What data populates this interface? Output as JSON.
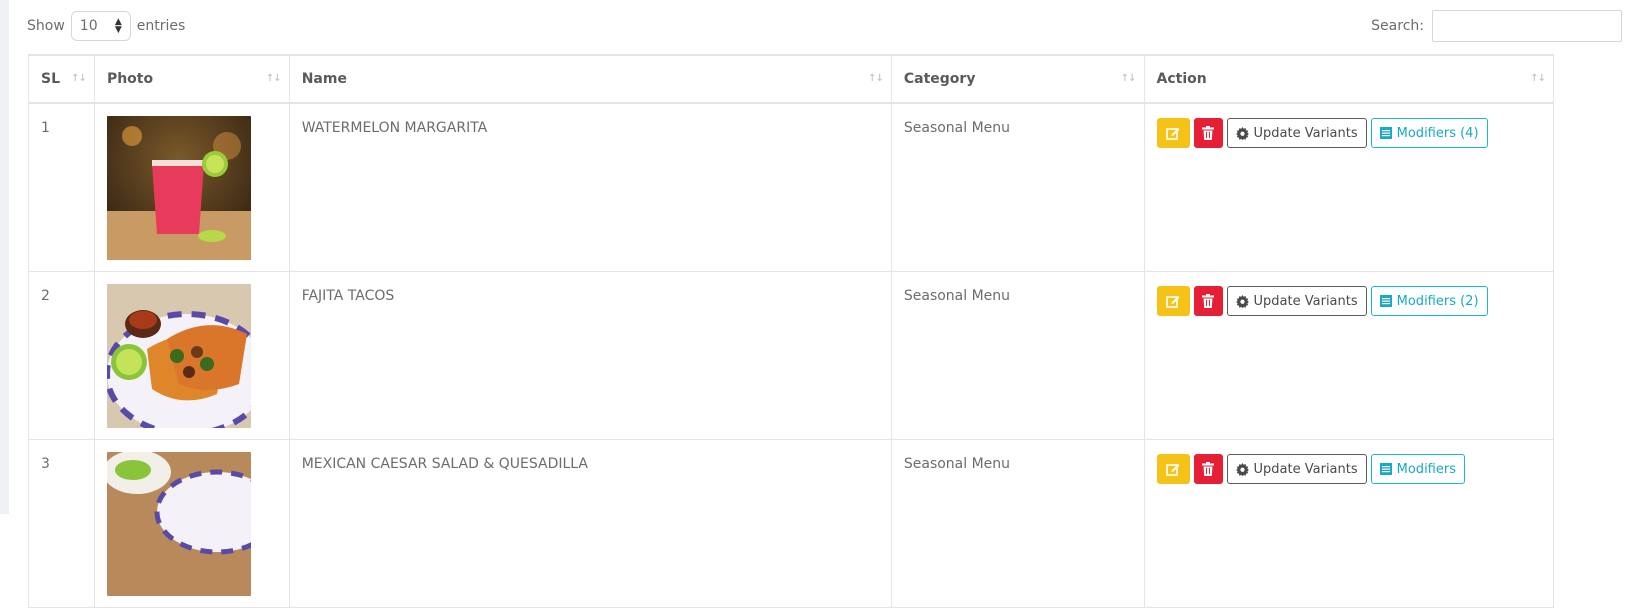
{
  "length_control": {
    "show_label": "Show",
    "selected": "10",
    "entries_label": "entries"
  },
  "search": {
    "label": "Search:",
    "value": ""
  },
  "columns": {
    "sl": "SL",
    "photo": "Photo",
    "name": "Name",
    "category": "Category",
    "action": "Action"
  },
  "rows": [
    {
      "sl": "1",
      "name": "WATERMELON MARGARITA",
      "category": "Seasonal Menu",
      "update_label": "Update Variants",
      "modifiers_label": "Modifiers (4)",
      "photo_icon": "drink-photo"
    },
    {
      "sl": "2",
      "name": "FAJITA TACOS",
      "category": "Seasonal Menu",
      "update_label": "Update Variants",
      "modifiers_label": "Modifiers (2)",
      "photo_icon": "tacos-photo"
    },
    {
      "sl": "3",
      "name": "MEXICAN CAESAR SALAD & QUESADILLA",
      "category": "Seasonal Menu",
      "update_label": "Update Variants",
      "modifiers_label": "Modifiers",
      "photo_icon": "salad-photo"
    }
  ],
  "icons": {
    "edit": "edit-icon",
    "delete": "trash-icon",
    "variants": "gear-icon",
    "modifiers": "list-icon",
    "sort": "sort-icon",
    "select_arrows": "chevron-updown-icon"
  },
  "colors": {
    "edit": "#f5c218",
    "delete": "#e51f35",
    "modifiers": "#1ab8d0",
    "border": "#e3e3ec"
  }
}
